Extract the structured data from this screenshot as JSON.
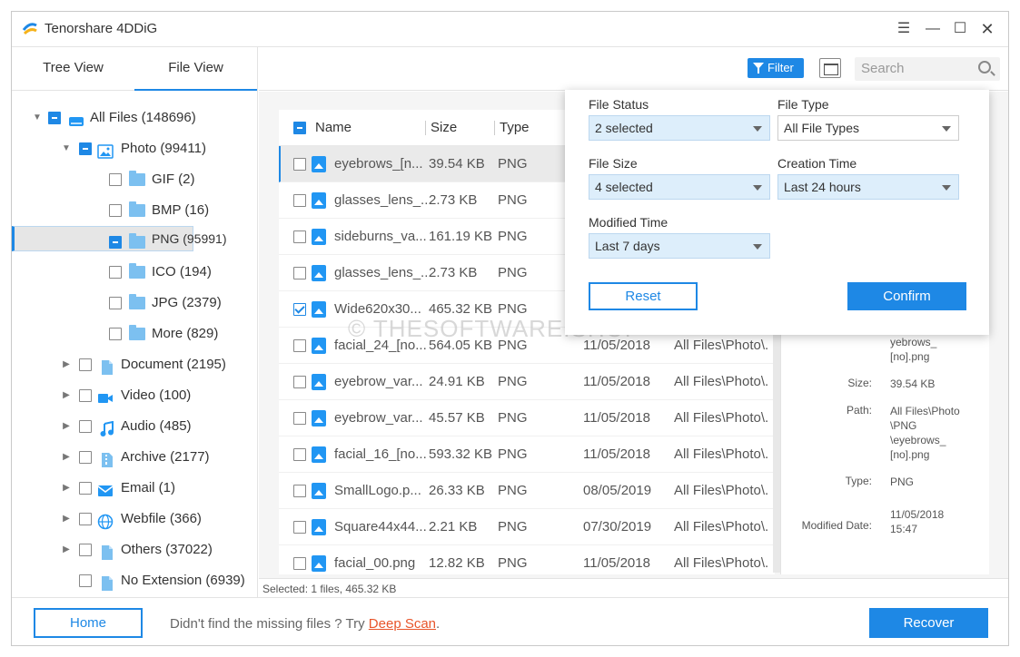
{
  "app": {
    "title": "Tenorshare 4DDiG"
  },
  "window_controls": [
    "menu-icon",
    "minimize-icon",
    "maximize-icon",
    "close-icon"
  ],
  "view_tabs": [
    {
      "label": "Tree View",
      "active": false
    },
    {
      "label": "File View",
      "active": true
    }
  ],
  "tree": [
    {
      "label": "All Files (148696)",
      "check": "partial",
      "expanded": true
    },
    {
      "label": "Photo (99411)",
      "check": "partial",
      "expanded": true
    },
    {
      "label": "GIF (2)",
      "check": "none"
    },
    {
      "label": "BMP (16)",
      "check": "none"
    },
    {
      "label": "PNG (95991)",
      "check": "partial",
      "selected": true
    },
    {
      "label": "ICO (194)",
      "check": "none"
    },
    {
      "label": "JPG (2379)",
      "check": "none"
    },
    {
      "label": "More (829)",
      "check": "none"
    },
    {
      "label": "Document (2195)",
      "check": "none"
    },
    {
      "label": "Video (100)",
      "check": "none"
    },
    {
      "label": "Audio (485)",
      "check": "none"
    },
    {
      "label": "Archive (2177)",
      "check": "none"
    },
    {
      "label": "Email (1)",
      "check": "none"
    },
    {
      "label": "Webfile (366)",
      "check": "none"
    },
    {
      "label": "Others (37022)",
      "check": "none"
    },
    {
      "label": "No Extension (6939)",
      "check": "none"
    }
  ],
  "toolbar": {
    "filter_label": "Filter",
    "search_placeholder": "Search"
  },
  "list": {
    "columns": [
      "Name",
      "Size",
      "Type"
    ],
    "rows": [
      {
        "name": "eyebrows_[n...",
        "size": "39.54 KB",
        "type": "PNG",
        "date": "",
        "path": "",
        "checked": false,
        "highlight": true
      },
      {
        "name": "glasses_lens_...",
        "size": "2.73 KB",
        "type": "PNG",
        "date": "",
        "path": "",
        "checked": false
      },
      {
        "name": "sideburns_va...",
        "size": "161.19 KB",
        "type": "PNG",
        "date": "",
        "path": "",
        "checked": false
      },
      {
        "name": "glasses_lens_...",
        "size": "2.73 KB",
        "type": "PNG",
        "date": "",
        "path": "",
        "checked": false
      },
      {
        "name": "Wide620x30...",
        "size": "465.32 KB",
        "type": "PNG",
        "date": "",
        "path": "",
        "checked": true
      },
      {
        "name": "facial_24_[no...",
        "size": "564.05 KB",
        "type": "PNG",
        "date": "11/05/2018",
        "path": "All Files\\Photo\\.",
        "checked": false
      },
      {
        "name": "eyebrow_var...",
        "size": "24.91 KB",
        "type": "PNG",
        "date": "11/05/2018",
        "path": "All Files\\Photo\\.",
        "checked": false
      },
      {
        "name": "eyebrow_var...",
        "size": "45.57 KB",
        "type": "PNG",
        "date": "11/05/2018",
        "path": "All Files\\Photo\\.",
        "checked": false
      },
      {
        "name": "facial_16_[no...",
        "size": "593.32 KB",
        "type": "PNG",
        "date": "11/05/2018",
        "path": "All Files\\Photo\\.",
        "checked": false
      },
      {
        "name": "SmallLogo.p...",
        "size": "26.33 KB",
        "type": "PNG",
        "date": "08/05/2019",
        "path": "All Files\\Photo\\.",
        "checked": false
      },
      {
        "name": "Square44x44...",
        "size": "2.21 KB",
        "type": "PNG",
        "date": "07/30/2019",
        "path": "All Files\\Photo\\.",
        "checked": false
      },
      {
        "name": "facial_00.png",
        "size": "12.82 KB",
        "type": "PNG",
        "date": "11/05/2018",
        "path": "All Files\\Photo\\.",
        "checked": false
      }
    ]
  },
  "details": {
    "name_tail1": "yebrows_",
    "name_tail2": "[no].png",
    "size_label": "Size:",
    "size_value": "39.54 KB",
    "path_label": "Path:",
    "path_value": "All Files\\Photo \\PNG \\eyebrows_ [no].png",
    "type_label": "Type:",
    "type_value": "PNG",
    "modified_label": "Modified Date:",
    "modified_value": "11/05/2018 15:47"
  },
  "status": {
    "text": "Selected: 1 files, 465.32 KB"
  },
  "filter_popup": {
    "file_status_label": "File Status",
    "file_status_value": "2 selected",
    "file_type_label": "File Type",
    "file_type_value": "All File Types",
    "file_size_label": "File Size",
    "file_size_value": "4 selected",
    "creation_time_label": "Creation Time",
    "creation_time_value": "Last 24 hours",
    "modified_time_label": "Modified Time",
    "modified_time_value": "Last 7 days",
    "reset_label": "Reset",
    "confirm_label": "Confirm"
  },
  "bottom": {
    "home_label": "Home",
    "hint_text": "Didn't find the missing files ? Try ",
    "deep_scan_label": "Deep Scan",
    "hint_end": ".",
    "recover_label": "Recover"
  },
  "watermark": "© THESOFTWARE.SHOP",
  "colors": {
    "accent": "#1e88e5",
    "link": "#e8552b"
  }
}
